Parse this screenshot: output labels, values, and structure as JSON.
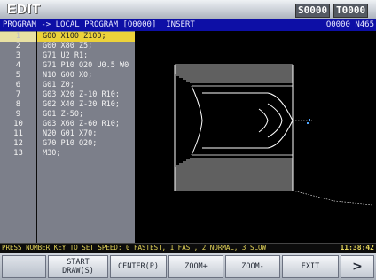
{
  "mode_bar": {
    "title": "EDIT",
    "spindle": "S0000",
    "tool": "T0000"
  },
  "header": {
    "path": "PROGRAM -> LOCAL PROGRAM [O0000]  INSERT",
    "right": "O0000 N465"
  },
  "program": {
    "active_line": 1,
    "lines": [
      {
        "num": "1",
        "text": "G00 X100 Z100;"
      },
      {
        "num": "2",
        "text": "G00 X80 Z5;"
      },
      {
        "num": "3",
        "text": "G71 U2 R1;"
      },
      {
        "num": "4",
        "text": "G71 P10 Q20 U0.5 W0"
      },
      {
        "num": "5",
        "text": "N10 G00 X0;"
      },
      {
        "num": "6",
        "text": "G01 Z0;"
      },
      {
        "num": "7",
        "text": "G03 X20 Z-10 R10;"
      },
      {
        "num": "8",
        "text": "G02 X40 Z-20 R10;"
      },
      {
        "num": "9",
        "text": "G01 Z-50;"
      },
      {
        "num": "10",
        "text": "G03 X60 Z-60 R10;"
      },
      {
        "num": "11",
        "text": "N20 G01 X70;"
      },
      {
        "num": "12",
        "text": "G70 P10 Q20;"
      },
      {
        "num": "13",
        "text": "M30;"
      }
    ]
  },
  "status": {
    "message": "PRESS NUMBER KEY TO SET SPEED: 0 FASTEST, 1 FAST, 2 NORMAL, 3 SLOW",
    "time": "11:38:42"
  },
  "softkeys": [
    {
      "label": ""
    },
    {
      "label": "START\nDRAW(S)"
    },
    {
      "label": "CENTER(P)"
    },
    {
      "label": "ZOOM+"
    },
    {
      "label": "ZOOM-"
    },
    {
      "label": "EXIT"
    },
    {
      "label": ">"
    }
  ],
  "colors": {
    "header_blue": "#0d0fa6",
    "active_line_yellow": "#ecd23a",
    "status_yellow": "#e7d75a",
    "toolpath_white": "#ffffff"
  }
}
